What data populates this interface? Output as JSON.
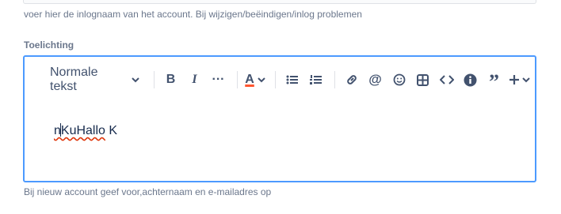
{
  "previous_field": {
    "help_text": "voer hier de inlognaam van het account. Bij wijzigen/beëindigen/inlog problemen"
  },
  "toelichting": {
    "label": "Toelichting",
    "help_text": "Bij nieuw account geef voor,achternaam en e-mailadres op",
    "editor": {
      "text_style": "Normale tekst",
      "content_before_caret": "n",
      "content_misspelled": "KuHallo",
      "content_after": " K"
    }
  },
  "colors": {
    "accent_border": "#4c9aff",
    "icon": "#42526e",
    "help_text": "#6b778c",
    "text_color_indicator": "#ff5630"
  },
  "toolbar_icons": [
    "chevron-down-icon",
    "bold-icon",
    "italic-icon",
    "more-icon",
    "text-color-icon",
    "bullet-list-icon",
    "numbered-list-icon",
    "link-icon",
    "mention-icon",
    "emoji-icon",
    "table-icon",
    "code-icon",
    "info-icon",
    "quote-icon",
    "plus-icon"
  ]
}
